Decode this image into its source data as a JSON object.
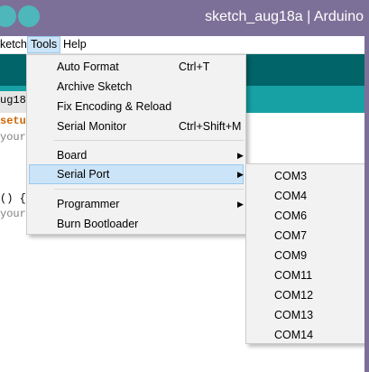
{
  "window": {
    "title": "sketch_aug18a | Arduino"
  },
  "menubar": {
    "sketch": "ketch",
    "tools": "Tools",
    "help": "Help"
  },
  "tab": {
    "label": "ug18a"
  },
  "editor": {
    "lines": [
      "setup",
      "your",
      "() {",
      "your"
    ]
  },
  "tools_menu": {
    "items": [
      {
        "label": "Auto Format",
        "shortcut": "Ctrl+T"
      },
      {
        "label": "Archive Sketch",
        "shortcut": ""
      },
      {
        "label": "Fix Encoding & Reload",
        "shortcut": ""
      },
      {
        "label": "Serial Monitor",
        "shortcut": "Ctrl+Shift+M"
      },
      {
        "label": "Board",
        "shortcut": ""
      },
      {
        "label": "Serial Port",
        "shortcut": ""
      },
      {
        "label": "Programmer",
        "shortcut": ""
      },
      {
        "label": "Burn Bootloader",
        "shortcut": ""
      }
    ],
    "arrow": "▶"
  },
  "serial_port_submenu": {
    "ports": [
      "COM3",
      "COM4",
      "COM6",
      "COM7",
      "COM9",
      "COM11",
      "COM12",
      "COM13",
      "COM14"
    ]
  },
  "colors": {
    "titlebar": "#7d7098",
    "toolbar": "#006468",
    "tabstrip": "#17a1a5",
    "highlight": "#cce4f7",
    "keyword": "#cc6600",
    "comment": "#7e7e7e"
  }
}
